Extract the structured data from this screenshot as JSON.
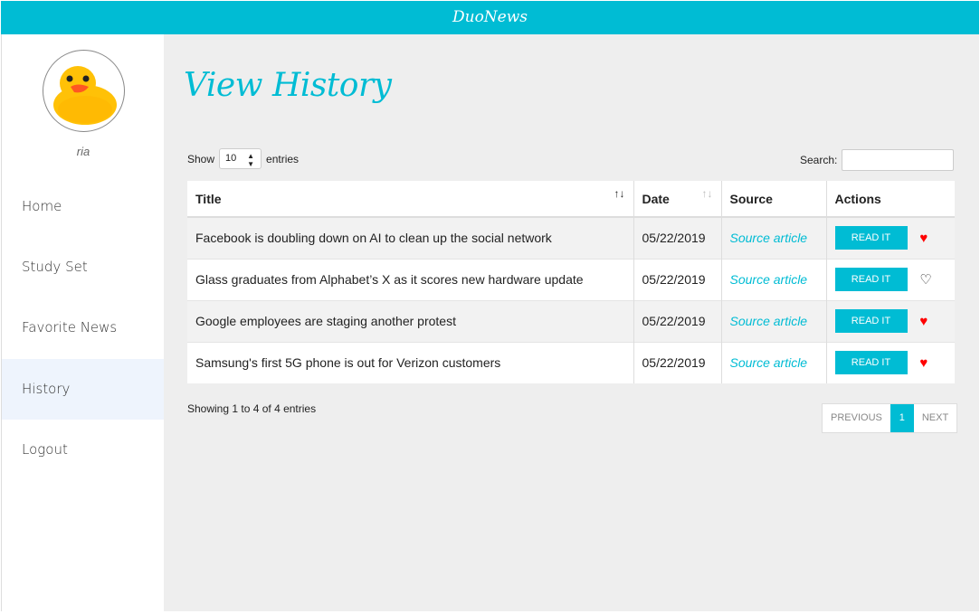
{
  "app": {
    "title": "DuoNews"
  },
  "user": {
    "name": "ria"
  },
  "sidebar": {
    "items": [
      {
        "label": "Home"
      },
      {
        "label": "Study Set"
      },
      {
        "label": "Favorite News"
      },
      {
        "label": "History",
        "active": true
      },
      {
        "label": "Logout"
      }
    ]
  },
  "page": {
    "title": "View History"
  },
  "table_controls": {
    "show_label": "Show",
    "entries_value": "10",
    "entries_label": "entries",
    "search_label": "Search:",
    "search_value": ""
  },
  "table": {
    "headers": [
      "Title",
      "Date",
      "Source",
      "Actions"
    ],
    "rows": [
      {
        "title": "Facebook is doubling down on AI to clean up the social network",
        "date": "05/22/2019",
        "source": "Source article",
        "action": "READ IT",
        "favorite": true
      },
      {
        "title": "Glass graduates from Alphabet’s X as it scores new hardware update",
        "date": "05/22/2019",
        "source": "Source article",
        "action": "READ IT",
        "favorite": false
      },
      {
        "title": "Google employees are staging another protest",
        "date": "05/22/2019",
        "source": "Source article",
        "action": "READ IT",
        "favorite": true
      },
      {
        "title": "Samsung's first 5G phone is out for Verizon customers",
        "date": "05/22/2019",
        "source": "Source article",
        "action": "READ IT",
        "favorite": true
      }
    ]
  },
  "footer": {
    "info": "Showing 1 to 4 of 4 entries",
    "prev": "PREVIOUS",
    "page": "1",
    "next": "NEXT"
  },
  "colors": {
    "accent": "#00bcd4",
    "heart": "#ff0000",
    "background": "#eeeeee"
  },
  "icons": {
    "favorite_filled": "heart-icon",
    "favorite_empty": "heart-outline-icon",
    "sort": "sort-icon"
  }
}
